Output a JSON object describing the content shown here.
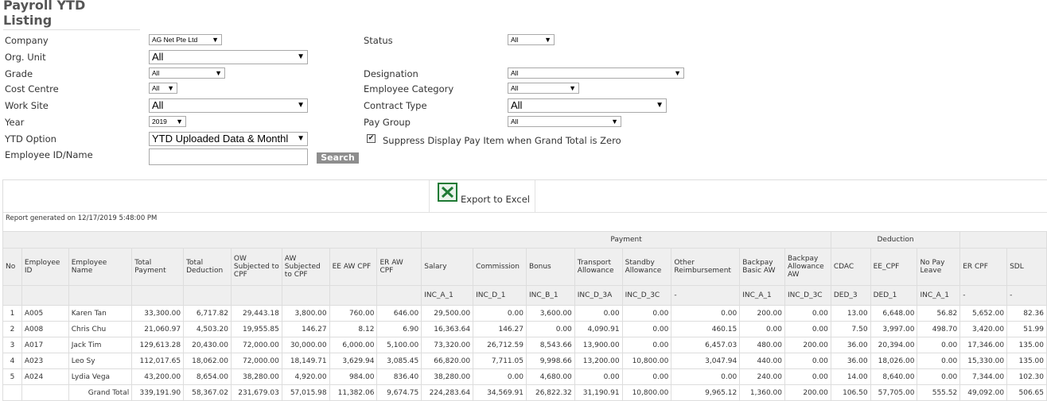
{
  "page_title": "Payroll YTD Listing",
  "filters": {
    "company": {
      "label": "Company",
      "value": "AG Net Pte Ltd"
    },
    "org_unit": {
      "label": "Org. Unit",
      "value": "All"
    },
    "grade": {
      "label": "Grade",
      "value": "All"
    },
    "cost_centre": {
      "label": "Cost Centre",
      "value": "All"
    },
    "work_site": {
      "label": "Work Site",
      "value": "All"
    },
    "year": {
      "label": "Year",
      "value": "2019"
    },
    "ytd_option": {
      "label": "YTD Option",
      "value": "YTD Uploaded Data & Monthl"
    },
    "employee": {
      "label": "Employee ID/Name",
      "value": ""
    },
    "status": {
      "label": "Status",
      "value": "All"
    },
    "designation": {
      "label": "Designation",
      "value": "All"
    },
    "employee_category": {
      "label": "Employee Category",
      "value": "All"
    },
    "contract_type": {
      "label": "Contract Type",
      "value": "All"
    },
    "pay_group": {
      "label": "Pay Group",
      "value": "All"
    },
    "suppress": {
      "label": "Suppress Display Pay Item when Grand Total is Zero",
      "checked": true
    },
    "search_label": "Search",
    "dropdown_arrow": "▼",
    "check_mark": "✔"
  },
  "report": {
    "export_label": "Export to Excel",
    "generated": "Report generated on 12/17/2019 5:48:00 PM",
    "group_headers": {
      "payment": "Payment",
      "deduction": "Deduction"
    },
    "columns": [
      {
        "label": "No",
        "code": ""
      },
      {
        "label": "Employee ID",
        "code": ""
      },
      {
        "label": "Employee Name",
        "code": ""
      },
      {
        "label": "Total Payment",
        "code": ""
      },
      {
        "label": "Total Deduction",
        "code": ""
      },
      {
        "label": "OW Subjected to CPF",
        "code": ""
      },
      {
        "label": "AW Subjected to CPF",
        "code": ""
      },
      {
        "label": "EE AW CPF",
        "code": ""
      },
      {
        "label": "ER AW CPF",
        "code": ""
      },
      {
        "label": "Salary",
        "code": "INC_A_1"
      },
      {
        "label": "Commission",
        "code": "INC_D_1"
      },
      {
        "label": "Bonus",
        "code": "INC_B_1"
      },
      {
        "label": "Transport Allowance",
        "code": "INC_D_3A"
      },
      {
        "label": "Standby Allowance",
        "code": "INC_D_3C"
      },
      {
        "label": "Other Reimbursement",
        "code": "-"
      },
      {
        "label": "Backpay Basic AW",
        "code": "INC_A_1"
      },
      {
        "label": "Backpay Allowance AW",
        "code": "INC_D_3C"
      },
      {
        "label": "CDAC",
        "code": "DED_3"
      },
      {
        "label": "EE_CPF",
        "code": "DED_1"
      },
      {
        "label": "No Pay Leave",
        "code": "INC_A_1"
      },
      {
        "label": "ER CPF",
        "code": "-"
      },
      {
        "label": "SDL",
        "code": "-"
      }
    ],
    "rows": [
      [
        "1",
        "A005",
        "Karen Tan",
        "33,300.00",
        "6,717.82",
        "29,443.18",
        "3,800.00",
        "760.00",
        "646.00",
        "29,500.00",
        "0.00",
        "3,600.00",
        "0.00",
        "0.00",
        "0.00",
        "200.00",
        "0.00",
        "13.00",
        "6,648.00",
        "56.82",
        "5,652.00",
        "82.36"
      ],
      [
        "2",
        "A008",
        "Chris Chu",
        "21,060.97",
        "4,503.20",
        "19,955.85",
        "146.27",
        "8.12",
        "6.90",
        "16,363.64",
        "146.27",
        "0.00",
        "4,090.91",
        "0.00",
        "460.15",
        "0.00",
        "0.00",
        "7.50",
        "3,997.00",
        "498.70",
        "3,420.00",
        "51.99"
      ],
      [
        "3",
        "A017",
        "Jack Tim",
        "129,613.28",
        "20,430.00",
        "72,000.00",
        "30,000.00",
        "6,000.00",
        "5,100.00",
        "73,320.00",
        "26,712.59",
        "8,543.66",
        "13,900.00",
        "0.00",
        "6,457.03",
        "480.00",
        "200.00",
        "36.00",
        "20,394.00",
        "0.00",
        "17,346.00",
        "135.00"
      ],
      [
        "4",
        "A023",
        "Leo Sy",
        "112,017.65",
        "18,062.00",
        "72,000.00",
        "18,149.71",
        "3,629.94",
        "3,085.45",
        "66,820.00",
        "7,711.05",
        "9,998.66",
        "13,200.00",
        "10,800.00",
        "3,047.94",
        "440.00",
        "0.00",
        "36.00",
        "18,026.00",
        "0.00",
        "15,330.00",
        "135.00"
      ],
      [
        "5",
        "A024",
        "Lydia Vega",
        "43,200.00",
        "8,654.00",
        "38,280.00",
        "4,920.00",
        "984.00",
        "836.40",
        "38,280.00",
        "0.00",
        "4,680.00",
        "0.00",
        "0.00",
        "0.00",
        "240.00",
        "0.00",
        "14.00",
        "8,640.00",
        "0.00",
        "7,344.00",
        "102.30"
      ]
    ],
    "grand_total": [
      "",
      "",
      "Grand Total",
      "339,191.90",
      "58,367.02",
      "231,679.03",
      "57,015.98",
      "11,382.06",
      "9,674.75",
      "224,283.64",
      "34,569.91",
      "26,822.32",
      "31,190.91",
      "10,800.00",
      "9,965.12",
      "1,360.00",
      "200.00",
      "106.50",
      "57,705.00",
      "555.52",
      "49,092.00",
      "506.65"
    ]
  }
}
